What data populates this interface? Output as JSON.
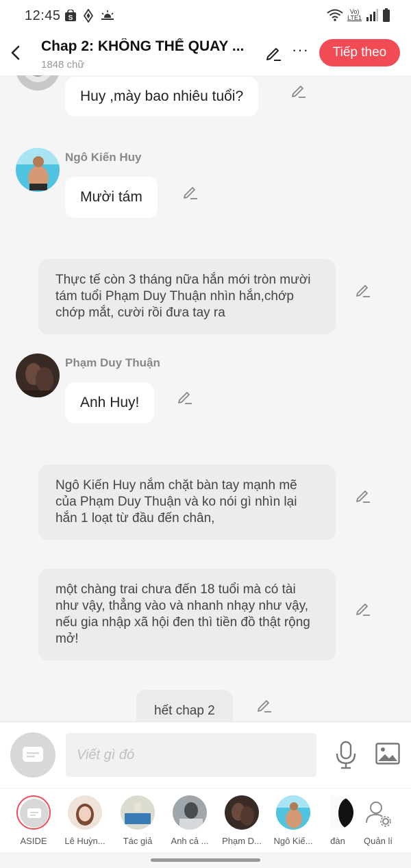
{
  "status_bar": {
    "time": "12:45",
    "lte_top": "Vo)",
    "lte_bottom": "LTE1"
  },
  "header": {
    "title": "Chap 2: KHÔNG THỂ QUAY ...",
    "word_count": "1848 chữ",
    "next_label": "Tiếp theo",
    "more_label": "···"
  },
  "messages": {
    "m1_text": "Huy ,mày bao nhiêu tuổi?",
    "m2_sender": "Ngô Kiến Huy",
    "m2_text": "Mười tám",
    "n1_text": "Thực tế còn 3 tháng nữa hắn mới tròn mười tám tuổi Phạm Duy Thuận nhìn hắn,chớp chớp mắt, cười rồi đưa tay ra",
    "m3_sender": "Phạm Duy Thuận",
    "m3_text": "Anh Huy!",
    "n2_text": "Ngô Kiến Huy nắm chặt bàn tay mạnh mẽ của Phạm Duy Thuận và ko nói gì nhìn lại hắn 1 loạt từ đầu đến chân,",
    "n3_text": "một chàng trai chưa đến 18 tuổi mà có tài như vậy, thẳng vào và nhanh nhạy như vậy, nếu gia nhập xã hội đen thì tiền đồ thật rộng mở!",
    "end_text": "hết chap 2"
  },
  "composer": {
    "placeholder": "Viết gì đó"
  },
  "characters": [
    {
      "label": "ASIDE"
    },
    {
      "label": "Lê Huỳn..."
    },
    {
      "label": "Tác giả"
    },
    {
      "label": "Anh cả ..."
    },
    {
      "label": "Phạm D..."
    },
    {
      "label": "Ngô Kiế..."
    },
    {
      "label": "đàn"
    },
    {
      "label": "Quản lí"
    }
  ],
  "colors": {
    "accent": "#f14c55",
    "bubble": "#ffffff",
    "narration": "#ececec",
    "background": "#f5f5f5"
  },
  "icons": [
    "back-arrow-icon",
    "pencil-icon",
    "more-icon",
    "microphone-icon",
    "image-icon",
    "chat-bubble-icon",
    "manage-user-icon"
  ]
}
